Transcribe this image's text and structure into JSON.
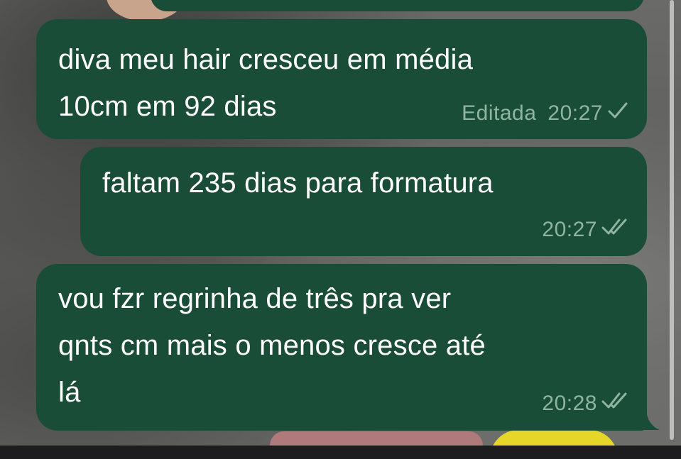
{
  "messages": [
    {
      "lines": [
        "diva meu hair cresceu em média",
        "10cm em 92 dias"
      ],
      "edited_label": "Editada",
      "time": "20:27",
      "status": "single-check-icon"
    },
    {
      "lines": [
        "faltam 235 dias para formatura"
      ],
      "time": "20:27",
      "status": "double-check-icon"
    },
    {
      "lines": [
        "vou fzr regrinha de três pra ver",
        "qnts cm mais o menos cresce até",
        "lá"
      ],
      "time": "20:28",
      "status": "double-check-icon"
    }
  ],
  "colors": {
    "bubble": "#1a4d37",
    "text": "#ffffff",
    "meta": "#8fb5a1"
  }
}
